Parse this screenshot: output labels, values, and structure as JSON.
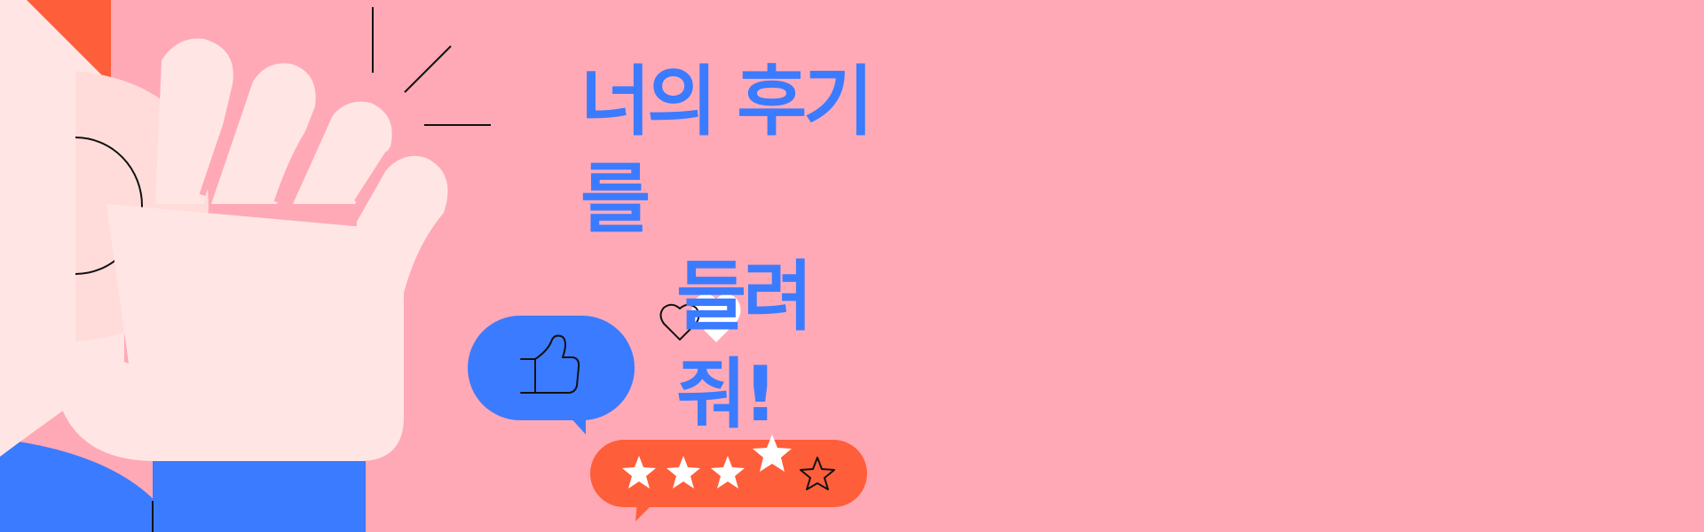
{
  "banner": {
    "headline_line1": "너의 후기를",
    "headline_line2": "들려줘!"
  },
  "rating": {
    "filled_stars": 4,
    "total_stars": 5
  },
  "icons": {
    "thumbs_up": "thumbs-up-icon",
    "heart_outline": "heart-outline-icon",
    "heart_filled": "heart-filled-icon",
    "star_filled": "star-filled-icon",
    "star_outline": "star-outline-icon"
  },
  "colors": {
    "background": "#ffa9b6",
    "hand": "#ffe6e4",
    "ear": "#ffdcda",
    "accent_blue": "#3b7bff",
    "accent_orange": "#ff5e3a",
    "white": "#ffffff",
    "outline": "#111111"
  }
}
